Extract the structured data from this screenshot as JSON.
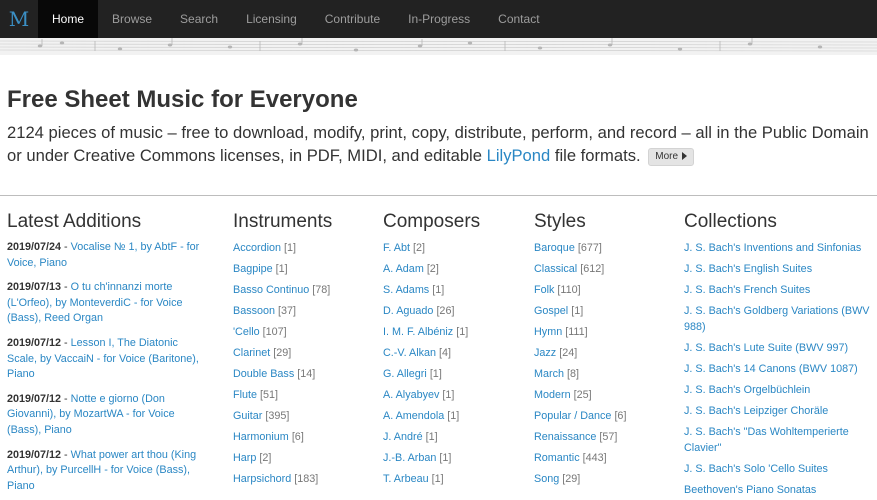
{
  "brand": {
    "logo_letter": "M"
  },
  "nav": {
    "items": [
      {
        "label": "Home",
        "active": true
      },
      {
        "label": "Browse"
      },
      {
        "label": "Search"
      },
      {
        "label": "Licensing"
      },
      {
        "label": "Contribute"
      },
      {
        "label": "In-Progress"
      },
      {
        "label": "Contact"
      }
    ]
  },
  "jumbo": {
    "title": "Free Sheet Music for Everyone",
    "text_before": "2124 pieces of music – free to download, modify, print, copy, distribute, perform, and record – all in the Public Domain or under Creative Commons licenses, in PDF, MIDI, and editable ",
    "link": "LilyPond",
    "text_after": " file formats.",
    "more_label": "More"
  },
  "latest": {
    "heading": "Latest Additions",
    "items": [
      {
        "date": "2019/07/24",
        "sep": " - ",
        "text": "Vocalise № 1, by AbtF - for Voice, Piano"
      },
      {
        "date": "2019/07/13",
        "sep": " - ",
        "text": "O tu ch'innanzi morte (L'Orfeo), by MonteverdiC - for Voice (Bass), Reed Organ"
      },
      {
        "date": "2019/07/12",
        "sep": " - ",
        "text": "Lesson I, The Diatonic Scale, by VaccaiN - for Voice (Baritone), Piano"
      },
      {
        "date": "2019/07/12",
        "sep": " - ",
        "text": "Notte e giorno (Don Giovanni), by MozartWA - for Voice (Bass), Piano"
      },
      {
        "date": "2019/07/12",
        "sep": " - ",
        "text": "What power art thou (King Arthur), by PurcellH - for Voice (Bass), Piano"
      }
    ]
  },
  "instruments": {
    "heading": "Instruments",
    "items": [
      {
        "name": "Accordion",
        "count": "[1]"
      },
      {
        "name": "Bagpipe",
        "count": "[1]"
      },
      {
        "name": "Basso Continuo",
        "count": "[78]"
      },
      {
        "name": "Bassoon",
        "count": "[37]"
      },
      {
        "name": "'Cello",
        "count": "[107]"
      },
      {
        "name": "Clarinet",
        "count": "[29]"
      },
      {
        "name": "Double Bass",
        "count": "[14]"
      },
      {
        "name": "Flute",
        "count": "[51]"
      },
      {
        "name": "Guitar",
        "count": "[395]"
      },
      {
        "name": "Harmonium",
        "count": "[6]"
      },
      {
        "name": "Harp",
        "count": "[2]"
      },
      {
        "name": "Harpsichord",
        "count": "[183]"
      }
    ]
  },
  "composers": {
    "heading": "Composers",
    "items": [
      {
        "name": "F. Abt",
        "count": "[2]"
      },
      {
        "name": "A. Adam",
        "count": "[2]"
      },
      {
        "name": "S. Adams",
        "count": "[1]"
      },
      {
        "name": "D. Aguado",
        "count": "[26]"
      },
      {
        "name": "I. M. F. Albéniz",
        "count": "[1]"
      },
      {
        "name": "C.-V. Alkan",
        "count": "[4]"
      },
      {
        "name": "G. Allegri",
        "count": "[1]"
      },
      {
        "name": "A. Alyabyev",
        "count": "[1]"
      },
      {
        "name": "A. Amendola",
        "count": "[1]"
      },
      {
        "name": "J. André",
        "count": "[1]"
      },
      {
        "name": "J.-B. Arban",
        "count": "[1]"
      },
      {
        "name": "T. Arbeau",
        "count": "[1]"
      }
    ]
  },
  "styles": {
    "heading": "Styles",
    "items": [
      {
        "name": "Baroque",
        "count": "[677]"
      },
      {
        "name": "Classical",
        "count": "[612]"
      },
      {
        "name": "Folk",
        "count": "[110]"
      },
      {
        "name": "Gospel",
        "count": "[1]"
      },
      {
        "name": "Hymn",
        "count": "[111]"
      },
      {
        "name": "Jazz",
        "count": "[24]"
      },
      {
        "name": "March",
        "count": "[8]"
      },
      {
        "name": "Modern",
        "count": "[25]"
      },
      {
        "name": "Popular / Dance",
        "count": "[6]"
      },
      {
        "name": "Renaissance",
        "count": "[57]"
      },
      {
        "name": "Romantic",
        "count": "[443]"
      },
      {
        "name": "Song",
        "count": "[29]"
      }
    ]
  },
  "collections": {
    "heading": "Collections",
    "items": [
      {
        "name": "J. S. Bach's Inventions and Sinfonias"
      },
      {
        "name": "J. S. Bach's English Suites"
      },
      {
        "name": "J. S. Bach's French Suites"
      },
      {
        "name": "J. S. Bach's Goldberg Variations (BWV 988)"
      },
      {
        "name": "J. S. Bach's Lute Suite (BWV 997)"
      },
      {
        "name": "J. S. Bach's 14 Canons (BWV 1087)"
      },
      {
        "name": "J. S. Bach's Orgelbüchlein"
      },
      {
        "name": "J. S. Bach's Leipziger Choräle"
      },
      {
        "name": "J. S. Bach's \"Das Wohltemperierte Clavier\""
      },
      {
        "name": "J. S. Bach's Solo 'Cello Suites"
      },
      {
        "name": "Beethoven's Piano Sonatas"
      }
    ]
  },
  "colors": {
    "navbar": "#222222",
    "link": "#2a87c4",
    "brand": "#3b8fc4"
  }
}
